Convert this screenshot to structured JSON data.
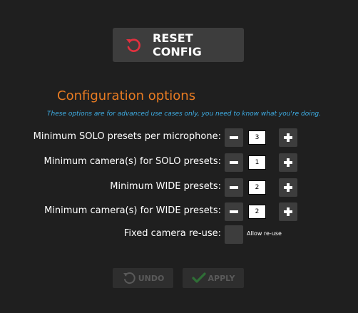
{
  "reset": {
    "label": "RESET CONFIG",
    "icon": "reset-icon",
    "icon_color": "#e2313f"
  },
  "config": {
    "title": "Configuration options",
    "subtitle": "These options are for advanced use cases only, you need to know what you're doing."
  },
  "rows": [
    {
      "label": "Minimum SOLO presets per microphone:",
      "value": "3"
    },
    {
      "label": "Minimum camera(s) for SOLO presets:",
      "value": "1"
    },
    {
      "label": "Minimum WIDE presets:",
      "value": "2"
    },
    {
      "label": "Minimum camera(s) for WIDE presets:",
      "value": "2"
    }
  ],
  "reuse": {
    "label": "Fixed camera re-use:",
    "checkbox_label": "Allow re-use",
    "checked": false
  },
  "actions": {
    "undo_label": "UNDO",
    "apply_label": "APPLY",
    "undo_icon": "undo-icon",
    "apply_icon": "checkmark-icon",
    "apply_icon_color": "#2f6e36"
  },
  "colors": {
    "background": "#1f1f1f",
    "title": "#e87b22",
    "subtitle": "#3fb0e8",
    "button": "#3d3d3d"
  }
}
